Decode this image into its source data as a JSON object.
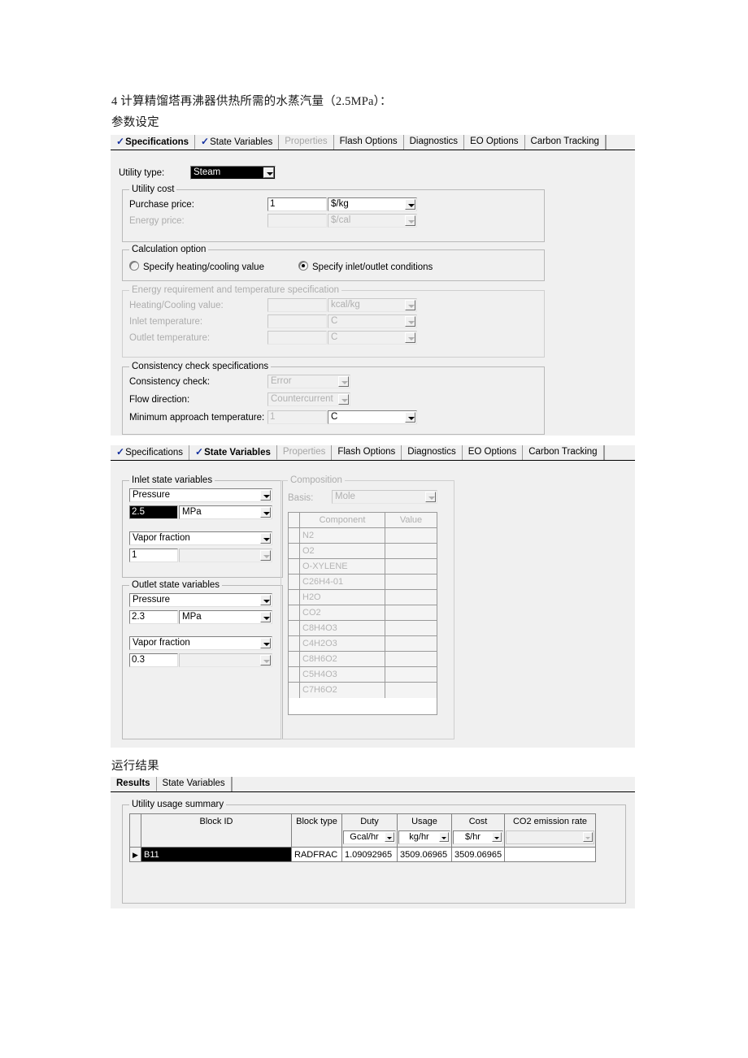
{
  "document": {
    "heading": "4 计算精馏塔再沸器供热所需的水蒸汽量（2.5MPa）：",
    "subheading": "参数设定",
    "results_label": "运行结果"
  },
  "spec_panel": {
    "tabs": [
      {
        "label": "Specifications",
        "check": "✓",
        "active": true,
        "disabled": false
      },
      {
        "label": "State Variables",
        "check": "✓",
        "active": false,
        "disabled": false
      },
      {
        "label": "Properties",
        "check": "",
        "active": false,
        "disabled": true
      },
      {
        "label": "Flash Options",
        "check": "",
        "active": false,
        "disabled": false
      },
      {
        "label": "Diagnostics",
        "check": "",
        "active": false,
        "disabled": false
      },
      {
        "label": "EO Options",
        "check": "",
        "active": false,
        "disabled": false
      },
      {
        "label": "Carbon Tracking",
        "check": "",
        "active": false,
        "disabled": false
      }
    ],
    "utility_type_label": "Utility type:",
    "utility_type_value": "Steam",
    "utility_cost": {
      "title": "Utility cost",
      "purchase_price_label": "Purchase price:",
      "purchase_price_value": "1",
      "purchase_price_unit": "$/kg",
      "energy_price_label": "Energy price:",
      "energy_price_value": "",
      "energy_price_unit": "$/cal"
    },
    "calculation_option": {
      "title": "Calculation option",
      "option_heating": "Specify heating/cooling value",
      "option_inlet_outlet": "Specify inlet/outlet conditions"
    },
    "energy_requirement": {
      "title": "Energy requirement and temperature specification",
      "heating_value_label": "Heating/Cooling value:",
      "heating_value_value": "",
      "heating_value_unit": "kcal/kg",
      "inlet_temp_label": "Inlet temperature:",
      "inlet_temp_value": "",
      "inlet_temp_unit": "C",
      "outlet_temp_label": "Outlet temperature:",
      "outlet_temp_value": "",
      "outlet_temp_unit": "C"
    },
    "consistency": {
      "title": "Consistency check specifications",
      "check_label": "Consistency check:",
      "check_value": "Error",
      "flow_label": "Flow direction:",
      "flow_value": "Countercurrent",
      "min_approach_label": "Minimum approach temperature:",
      "min_approach_value": "1",
      "min_approach_unit": "C"
    }
  },
  "state_panel": {
    "tabs": [
      {
        "label": "Specifications",
        "check": "✓",
        "active": false,
        "disabled": false
      },
      {
        "label": "State Variables",
        "check": "✓",
        "active": true,
        "disabled": false
      },
      {
        "label": "Properties",
        "check": "",
        "active": false,
        "disabled": true
      },
      {
        "label": "Flash Options",
        "check": "",
        "active": false,
        "disabled": false
      },
      {
        "label": "Diagnostics",
        "check": "",
        "active": false,
        "disabled": false
      },
      {
        "label": "EO Options",
        "check": "",
        "active": false,
        "disabled": false
      },
      {
        "label": "Carbon Tracking",
        "check": "",
        "active": false,
        "disabled": false
      }
    ],
    "inlet": {
      "title": "Inlet state variables",
      "var1": "Pressure",
      "val1": "2.5",
      "unit1": "MPa",
      "var2": "Vapor fraction",
      "val2": "1",
      "unit2": ""
    },
    "outlet": {
      "title": "Outlet state variables",
      "var1": "Pressure",
      "val1": "2.3",
      "unit1": "MPa",
      "var2": "Vapor fraction",
      "val2": "0.3",
      "unit2": ""
    },
    "composition": {
      "title": "Composition",
      "basis_label": "Basis:",
      "basis_value": "Mole",
      "headers": [
        "Component",
        "Value"
      ],
      "rows": [
        {
          "component": "N2",
          "value": ""
        },
        {
          "component": "O2",
          "value": ""
        },
        {
          "component": "O-XYLENE",
          "value": ""
        },
        {
          "component": "C26H4-01",
          "value": ""
        },
        {
          "component": "H2O",
          "value": ""
        },
        {
          "component": "CO2",
          "value": ""
        },
        {
          "component": "C8H4O3",
          "value": ""
        },
        {
          "component": "C4H2O3",
          "value": ""
        },
        {
          "component": "C8H6O2",
          "value": ""
        },
        {
          "component": "C5H4O3",
          "value": ""
        },
        {
          "component": "C7H6O2",
          "value": ""
        }
      ]
    }
  },
  "results_panel": {
    "tabs": [
      {
        "label": "Results",
        "active": true
      },
      {
        "label": "State Variables",
        "active": false
      }
    ],
    "summary_title": "Utility usage summary",
    "columns": [
      {
        "header": "Block ID",
        "unit": ""
      },
      {
        "header": "Block type",
        "unit": ""
      },
      {
        "header": "Duty",
        "unit": "Gcal/hr"
      },
      {
        "header": "Usage",
        "unit": "kg/hr"
      },
      {
        "header": "Cost",
        "unit": "$/hr"
      },
      {
        "header": "CO2 emission rate",
        "unit": ""
      }
    ],
    "rows": [
      {
        "marker": "▶",
        "block_id": "B11",
        "block_type": "RADFRAC",
        "duty": "1.09092965",
        "usage": "3509.06965",
        "cost": "3509.06965",
        "co2": ""
      }
    ]
  },
  "colors": {
    "panel_bg": "#f0f0f0",
    "check_blue": "#1430a0",
    "selection_black": "#000000"
  }
}
